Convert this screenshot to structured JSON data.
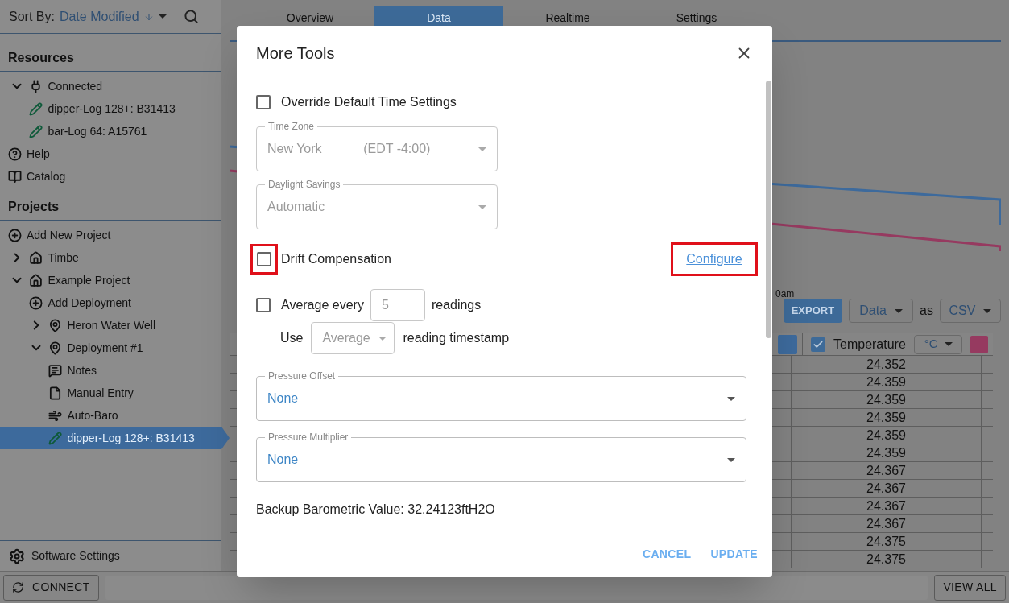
{
  "sidebar": {
    "sort_label": "Sort By:",
    "sort_value": "Date Modified",
    "resources_title": "Resources",
    "resources": [
      {
        "label": "Connected",
        "kind": "plug",
        "expanded": true,
        "selected": false,
        "children": [
          {
            "label": "dipper-Log 128+: B31413",
            "kind": "logger",
            "selected": false
          },
          {
            "label": "bar-Log 64: A15761",
            "kind": "logger",
            "selected": false
          }
        ]
      },
      {
        "label": "Help",
        "kind": "help",
        "selected": false
      },
      {
        "label": "Catalog",
        "kind": "book",
        "selected": false
      }
    ],
    "projects_title": "Projects",
    "projects": [
      {
        "label": "Add New Project",
        "kind": "add",
        "selected": false
      },
      {
        "label": "Timbe",
        "kind": "home",
        "expanded": false,
        "selected": false
      },
      {
        "label": "Example Project",
        "kind": "home",
        "expanded": true,
        "selected": false,
        "children": [
          {
            "label": "Add Deployment",
            "kind": "add",
            "selected": false
          },
          {
            "label": "Heron Water Well",
            "kind": "pin",
            "expanded": false,
            "selected": false
          },
          {
            "label": "Deployment #1",
            "kind": "pin",
            "expanded": true,
            "selected": false,
            "children": [
              {
                "label": "Notes",
                "kind": "notes",
                "selected": false
              },
              {
                "label": "Manual Entry",
                "kind": "file",
                "selected": false
              },
              {
                "label": "Auto-Baro",
                "kind": "wind",
                "selected": false
              },
              {
                "label": "dipper-Log 128+: B31413",
                "kind": "logger",
                "selected": true
              }
            ]
          }
        ]
      }
    ],
    "settings_label": "Software Settings"
  },
  "tabs": [
    {
      "label": "Overview",
      "selected": false
    },
    {
      "label": "Data",
      "selected": true
    },
    {
      "label": "Realtime",
      "selected": false
    },
    {
      "label": "Settings",
      "selected": false
    }
  ],
  "chart": {
    "axis_label": "0am"
  },
  "toolbar": {
    "export": "EXPORT",
    "source": "Data",
    "joiner": "as",
    "format": "CSV"
  },
  "table": {
    "columns": [
      {
        "color": "#3d6a9c"
      },
      {
        "label": "Temperature",
        "unit": "°C",
        "checked": true,
        "color": "#963a60"
      }
    ],
    "rows": [
      "24.352",
      "24.359",
      "24.359",
      "24.359",
      "24.359",
      "24.359",
      "24.367",
      "24.367",
      "24.367",
      "24.367",
      "24.375",
      "24.375"
    ]
  },
  "bottom_bar": {
    "connect": "CONNECT",
    "view_all": "VIEW ALL"
  },
  "dialog": {
    "title": "More Tools",
    "override": {
      "label": "Override Default Time Settings",
      "checked": false
    },
    "time_zone": {
      "label": "Time Zone",
      "value": "New York",
      "suffix": "(EDT -4:00)",
      "disabled": true
    },
    "daylight_savings": {
      "label": "Daylight Savings",
      "value": "Automatic",
      "disabled": true
    },
    "drift": {
      "label": "Drift Compensation",
      "checked": false,
      "highlighted": true
    },
    "configure": {
      "label": "Configure",
      "highlighted": true
    },
    "average": {
      "label_before": "Average every",
      "value": "5",
      "label_after": "readings",
      "checked": false,
      "disabled": true
    },
    "timestamp": {
      "label_before": "Use",
      "value": "Average",
      "label_after": "reading timestamp",
      "disabled": true
    },
    "pressure_offset": {
      "label": "Pressure Offset",
      "value": "None",
      "disabled": false
    },
    "pressure_multiplier": {
      "label": "Pressure Multiplier",
      "value": "None",
      "disabled": false
    },
    "backup": "Backup Barometric Value: 32.24123ftH2O",
    "buttons": [
      {
        "label": "CANCEL"
      },
      {
        "label": "UPDATE"
      }
    ]
  }
}
